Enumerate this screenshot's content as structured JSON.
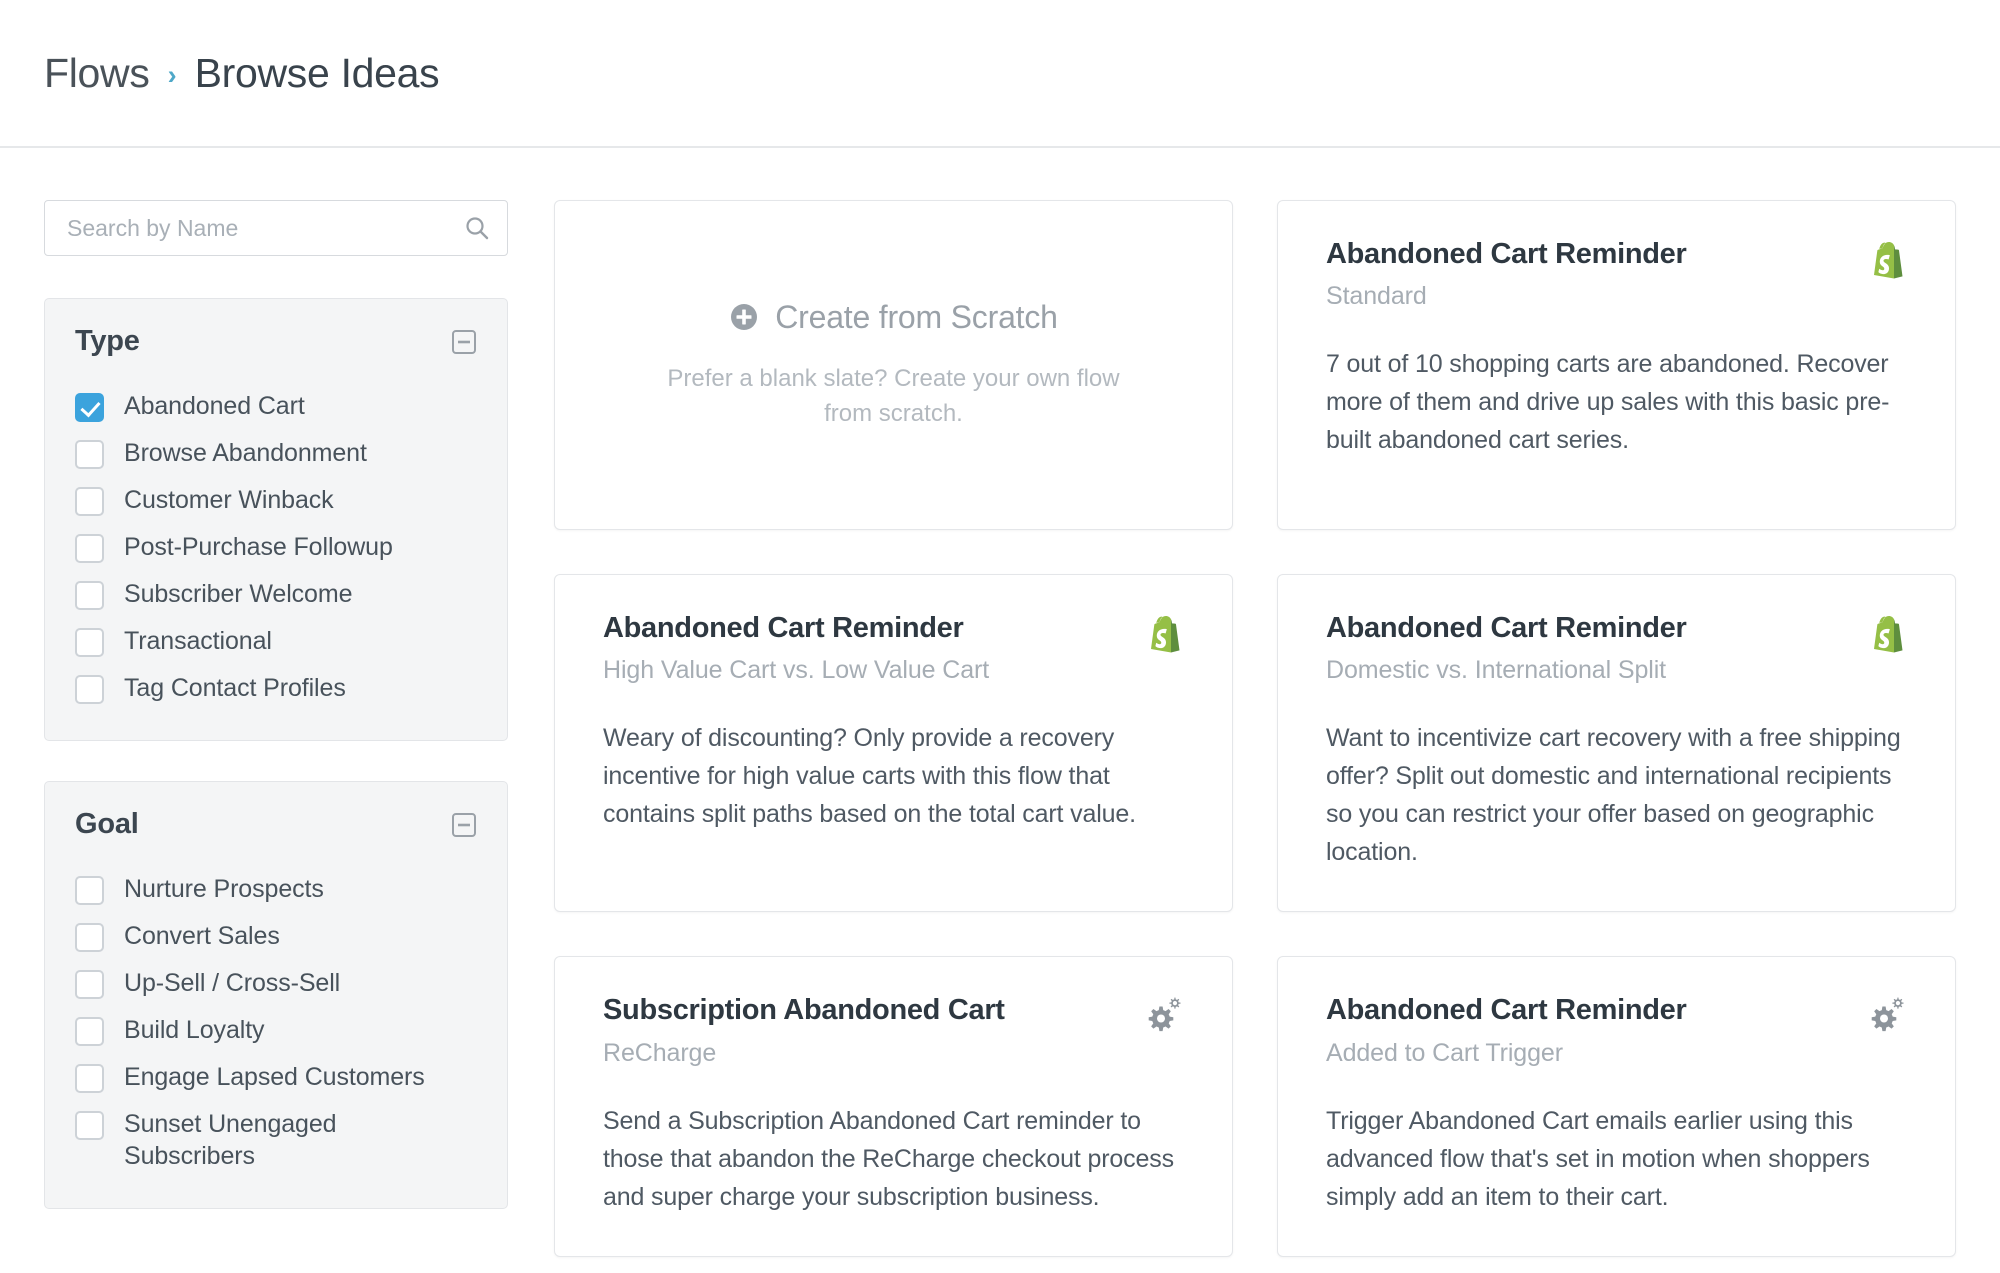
{
  "header": {
    "breadcrumb": {
      "parent": "Flows",
      "separator": "›",
      "current": "Browse Ideas"
    }
  },
  "sidebar": {
    "search": {
      "placeholder": "Search by Name",
      "value": "",
      "icon": "search-icon"
    },
    "filters": [
      {
        "title": "Type",
        "collapse_icon": "minus-square-icon",
        "options": [
          {
            "label": "Abandoned Cart",
            "checked": true
          },
          {
            "label": "Browse Abandonment",
            "checked": false
          },
          {
            "label": "Customer Winback",
            "checked": false
          },
          {
            "label": "Post-Purchase Followup",
            "checked": false
          },
          {
            "label": "Subscriber Welcome",
            "checked": false
          },
          {
            "label": "Transactional",
            "checked": false
          },
          {
            "label": "Tag Contact Profiles",
            "checked": false
          }
        ]
      },
      {
        "title": "Goal",
        "collapse_icon": "minus-square-icon",
        "options": [
          {
            "label": "Nurture Prospects",
            "checked": false
          },
          {
            "label": "Convert Sales",
            "checked": false
          },
          {
            "label": "Up-Sell / Cross-Sell",
            "checked": false
          },
          {
            "label": "Build Loyalty",
            "checked": false
          },
          {
            "label": "Engage Lapsed Customers",
            "checked": false
          },
          {
            "label": "Sunset Unengaged Subscribers",
            "checked": false
          }
        ]
      }
    ]
  },
  "main": {
    "create_card": {
      "icon": "plus-circle-icon",
      "title": "Create from Scratch",
      "subtitle": "Prefer a blank slate? Create your own flow from scratch."
    },
    "cards": [
      {
        "title": "Abandoned Cart Reminder",
        "subtitle": "Standard",
        "badge": "shopify-icon",
        "description": "7 out of 10 shopping carts are abandoned. Recover more of them and drive up sales with this basic pre-built abandoned cart series."
      },
      {
        "title": "Abandoned Cart Reminder",
        "subtitle": "High Value Cart vs. Low Value Cart",
        "badge": "shopify-icon",
        "description": "Weary of discounting? Only provide a recovery incentive for high value carts with this flow that contains split paths based on the total cart value."
      },
      {
        "title": "Abandoned Cart Reminder",
        "subtitle": "Domestic vs. International Split",
        "badge": "shopify-icon",
        "description": "Want to incentivize cart recovery with a free shipping offer? Split out domestic and international recipients so you can restrict your offer based on geographic location."
      },
      {
        "title": "Subscription Abandoned Cart",
        "subtitle": "ReCharge",
        "badge": "gears-icon",
        "description": "Send a Subscription Abandoned Cart reminder to those that abandon the ReCharge checkout process and super charge your subscription business."
      },
      {
        "title": "Abandoned Cart Reminder",
        "subtitle": "Added to Cart Trigger",
        "badge": "gears-icon",
        "description": "Trigger Abandoned Cart emails earlier using this advanced flow that's set in motion when shoppers simply add an item to their cart."
      }
    ]
  },
  "colors": {
    "accent_blue": "#3ba3dd",
    "breadcrumb_separator": "#4fa8c8",
    "shopify_green": "#7ab55c",
    "panel_bg": "#f4f5f6",
    "text_primary": "#2e3841",
    "text_muted": "#a6adb4"
  }
}
